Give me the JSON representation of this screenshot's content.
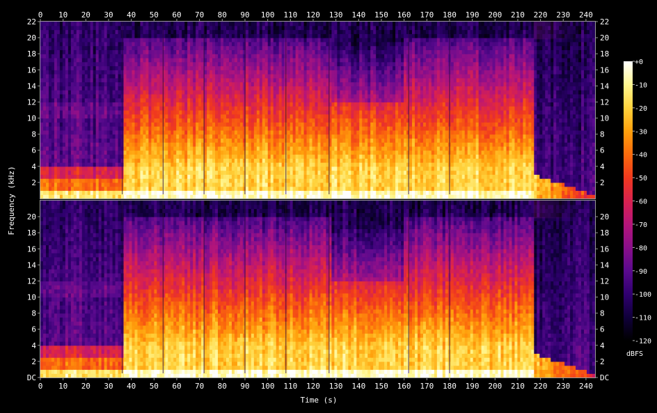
{
  "chart_data": {
    "type": "heatmap",
    "title": "",
    "xlabel": "Time (s)",
    "ylabel": "Frequency (kHz)",
    "xlim": [
      0,
      244
    ],
    "ylim": [
      0,
      22
    ],
    "x_ticks": [
      "0",
      "10",
      "20",
      "30",
      "40",
      "50",
      "60",
      "70",
      "80",
      "90",
      "100",
      "110",
      "120",
      "130",
      "140",
      "150",
      "160",
      "170",
      "180",
      "190",
      "200",
      "210",
      "220",
      "230",
      "240"
    ],
    "y_ticks_top": [
      "2",
      "4",
      "6",
      "8",
      "10",
      "12",
      "14",
      "16",
      "18",
      "20",
      "22"
    ],
    "y_ticks_bottom": [
      "DC",
      "2",
      "4",
      "6",
      "8",
      "10",
      "12",
      "14",
      "16",
      "18",
      "20"
    ],
    "channels": 2,
    "colorbar": {
      "label": "dBFS",
      "range": [
        -120,
        0
      ],
      "ticks": [
        "+0",
        "-10",
        "-20",
        "-30",
        "-40",
        "-50",
        "-60",
        "-70",
        "-80",
        "-90",
        "-100",
        "-110",
        "-120"
      ],
      "palette": [
        "#000000",
        "#10003a",
        "#300070",
        "#5a0a8e",
        "#8a0f8a",
        "#b5157a",
        "#d8224f",
        "#f0391e",
        "#fb6b0c",
        "#ffa00c",
        "#ffd23c",
        "#fff690",
        "#ffffff"
      ]
    },
    "activity_segments": [
      {
        "t0": 0,
        "t1": 36,
        "level": "low",
        "bandwidth_khz": 4
      },
      {
        "t0": 36,
        "t1": 217,
        "level": "high",
        "bandwidth_khz": 20
      },
      {
        "t0": 217,
        "t1": 244,
        "level": "fade",
        "bandwidth_khz": 2
      }
    ],
    "note_marks_s": [
      36,
      54,
      72,
      90,
      108,
      127,
      162,
      180
    ]
  }
}
